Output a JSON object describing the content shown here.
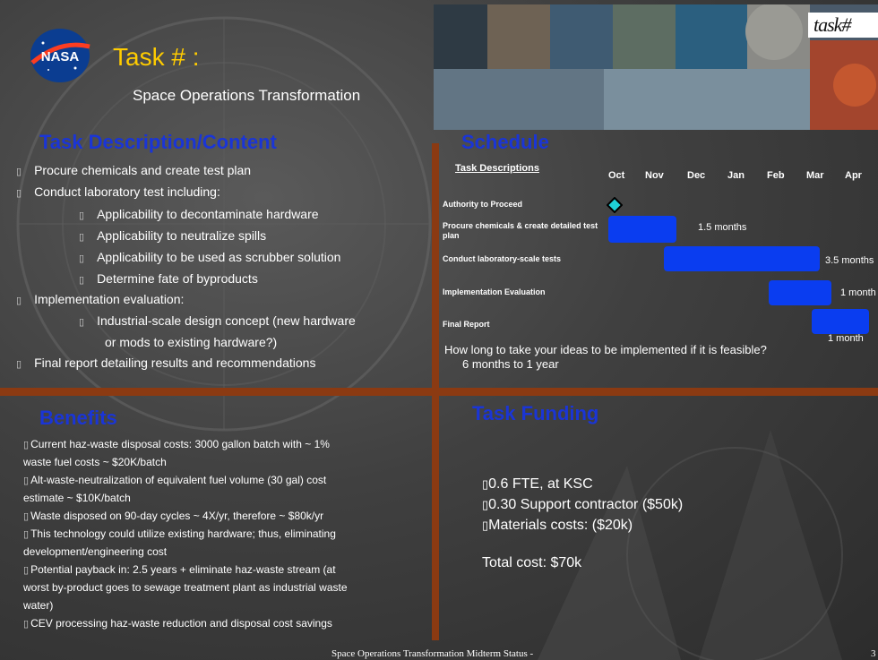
{
  "header": {
    "title": "Task # :",
    "subtitle": "Space Operations Transformation",
    "badge": "task#"
  },
  "description": {
    "heading": "Task Description/Content",
    "lines": [
      "Procure chemicals and create test plan",
      "Conduct laboratory test including:",
      "Applicability to decontaminate hardware",
      "Applicability to neutralize spills",
      "Applicability to be used as scrubber solution",
      "Determine fate of byproducts",
      "Implementation evaluation:",
      "Industrial-scale design concept (new hardware",
      "or mods to existing hardware?)",
      "Final report detailing results and recommendations"
    ]
  },
  "schedule": {
    "heading": "Schedule",
    "column_header": "Task Descriptions",
    "months": [
      "Oct",
      "Nov",
      "Dec",
      "Jan",
      "Feb",
      "Mar",
      "Apr"
    ],
    "tasks": [
      {
        "label": "Authority to Proceed",
        "duration": ""
      },
      {
        "label": "Procure chemicals & create detailed test plan",
        "duration": "1.5 months"
      },
      {
        "label": "Conduct laboratory-scale tests",
        "duration": "3.5 months"
      },
      {
        "label": "Implementation Evaluation",
        "duration": "1 month"
      },
      {
        "label": "Final Report",
        "duration": "1 month"
      }
    ],
    "question": "How long to take your ideas to be implemented if it is feasible?",
    "answer": "6 months to 1 year"
  },
  "benefits": {
    "heading": "Benefits",
    "lines": [
      "Current haz-waste disposal costs:  3000 gallon batch with ~ 1%",
      "waste fuel costs ~ $20K/batch",
      "Alt-waste-neutralization of equivalent fuel volume (30 gal) cost",
      "estimate ~ $10K/batch",
      "Waste disposed on 90-day cycles ~ 4X/yr, therefore ~ $80k/yr",
      "This technology could utilize existing hardware; thus, eliminating",
      "development/engineering cost",
      "Potential payback in: 2.5 years + eliminate haz-waste stream (at",
      "worst by-product goes to sewage treatment plant as industrial waste",
      "water)",
      "CEV processing haz-waste reduction and disposal cost savings"
    ]
  },
  "funding": {
    "heading": "Task Funding",
    "items": [
      "0.6 FTE, at KSC",
      "0.30 Support contractor ($50k)",
      "Materials costs: ($20k)"
    ],
    "total": "Total cost: $70k"
  },
  "footer": {
    "text": "Space Operations Transformation Midterm Status -",
    "page": "3"
  },
  "colors": {
    "heading_blue": "#1a35d6",
    "title_yellow": "#ffcc00",
    "divider": "#8b3a12",
    "gantt_bar": "#0a3df0"
  }
}
